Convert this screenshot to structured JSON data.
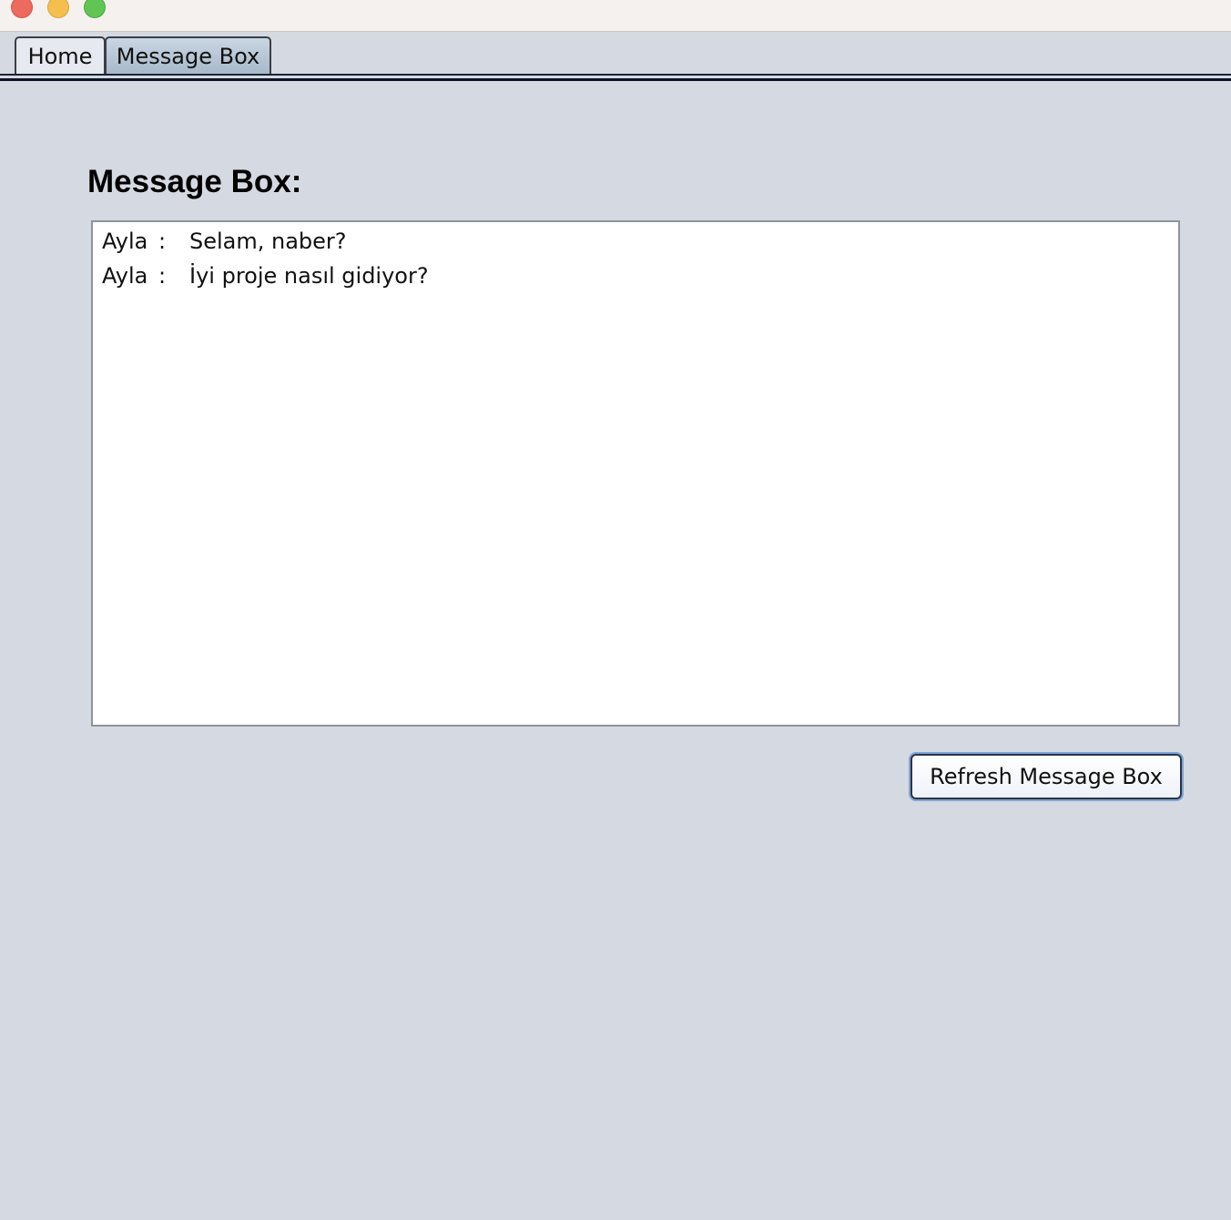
{
  "window": {
    "controls": [
      "close-icon",
      "minimize-icon",
      "zoom-icon"
    ],
    "colors": {
      "close": "#ed6a5e",
      "minimize": "#f5bf4f",
      "zoom": "#61c554"
    }
  },
  "tabs": [
    {
      "label": "Home",
      "selected": false
    },
    {
      "label": "Message Box",
      "selected": true
    }
  ],
  "main": {
    "heading": "Message Box:",
    "messages": [
      {
        "sender": "Ayla",
        "separator": ":",
        "text": "Selam, naber?"
      },
      {
        "sender": "Ayla",
        "separator": ":",
        "text": "İyi proje nasıl gidiyor?"
      }
    ],
    "refresh_label": "Refresh Message Box"
  }
}
